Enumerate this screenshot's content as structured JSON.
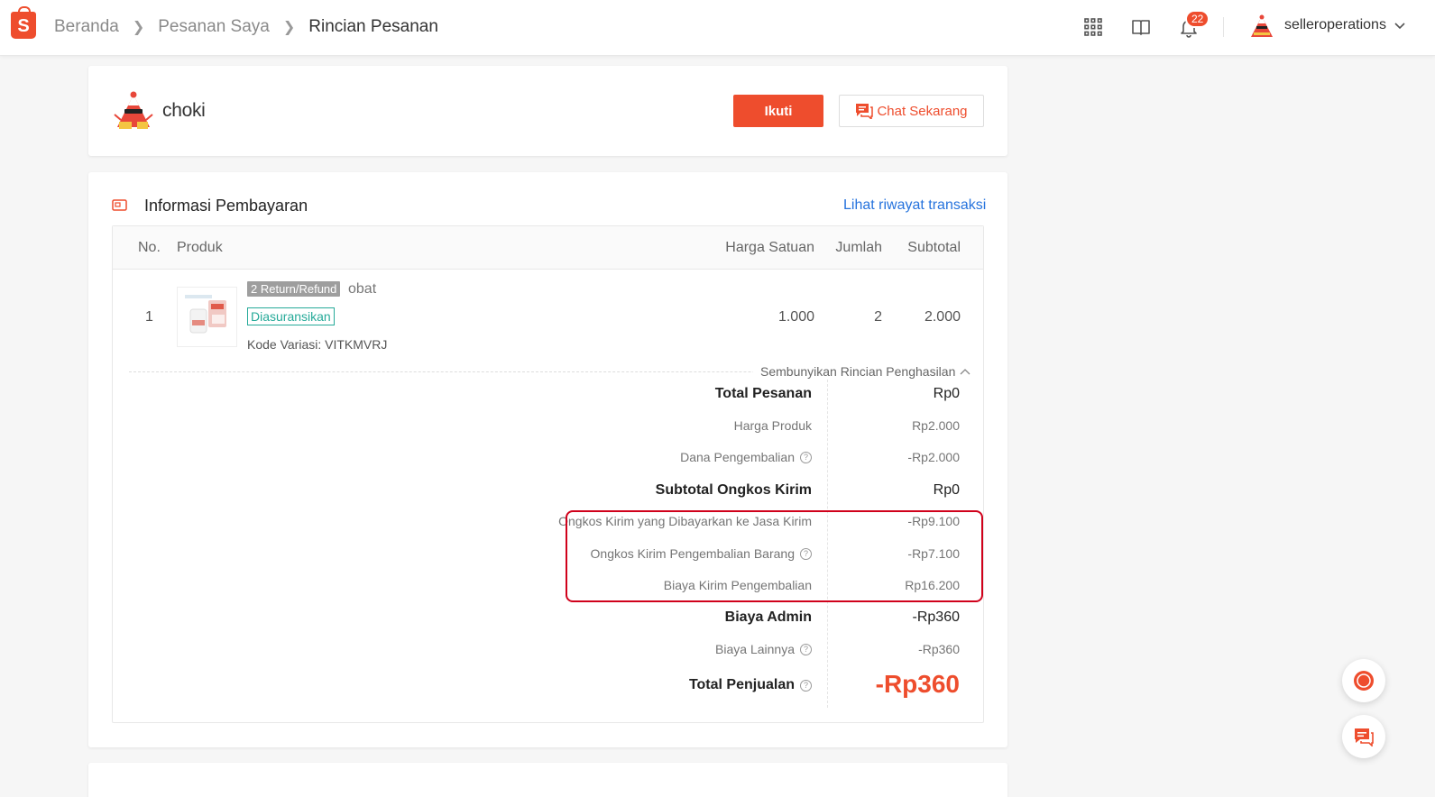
{
  "header": {
    "logo": "S",
    "breadcrumbs": [
      "Beranda",
      "Pesanan Saya",
      "Rincian Pesanan"
    ],
    "notification_count": "22",
    "username": "selleroperations"
  },
  "shop": {
    "name": "choki",
    "follow_label": "Ikuti",
    "chat_label": "Chat Sekarang"
  },
  "payment": {
    "title": "Informasi Pembayaran",
    "history_link": "Lihat riwayat transaksi",
    "columns": {
      "no": "No.",
      "product": "Produk",
      "unit_price": "Harga Satuan",
      "qty": "Jumlah",
      "subtotal": "Subtotal"
    },
    "item": {
      "no": "1",
      "return_tag": "2 Return/Refund",
      "name": "obat",
      "insured_tag": "Diasuransikan",
      "variation": "Kode Variasi: VITKMVRJ",
      "unit_price": "1.000",
      "qty": "2",
      "subtotal": "2.000"
    },
    "toggle_label": "Sembunyikan Rincian Penghasilan",
    "breakdown": [
      {
        "label": "Total Pesanan",
        "value": "Rp0",
        "bold": true,
        "help": false
      },
      {
        "label": "Harga Produk",
        "value": "Rp2.000",
        "bold": false,
        "help": false
      },
      {
        "label": "Dana Pengembalian",
        "value": "-Rp2.000",
        "bold": false,
        "help": true
      },
      {
        "label": "Subtotal Ongkos Kirim",
        "value": "Rp0",
        "bold": true,
        "help": false
      },
      {
        "label": "Ongkos Kirim yang Dibayarkan ke Jasa Kirim",
        "value": "-Rp9.100",
        "bold": false,
        "help": false
      },
      {
        "label": "Ongkos Kirim Pengembalian Barang",
        "value": "-Rp7.100",
        "bold": false,
        "help": true
      },
      {
        "label": "Biaya Kirim Pengembalian",
        "value": "Rp16.200",
        "bold": false,
        "help": false
      },
      {
        "label": "Biaya Admin",
        "value": "-Rp360",
        "bold": true,
        "help": false
      },
      {
        "label": "Biaya Lainnya",
        "value": "-Rp360",
        "bold": false,
        "help": true
      }
    ],
    "total": {
      "label": "Total Penjualan",
      "value": "-Rp360"
    }
  },
  "colors": {
    "brand": "#ee4d2d",
    "link": "#2673dd",
    "insured": "#26aa99",
    "highlight": "#d0011b"
  }
}
